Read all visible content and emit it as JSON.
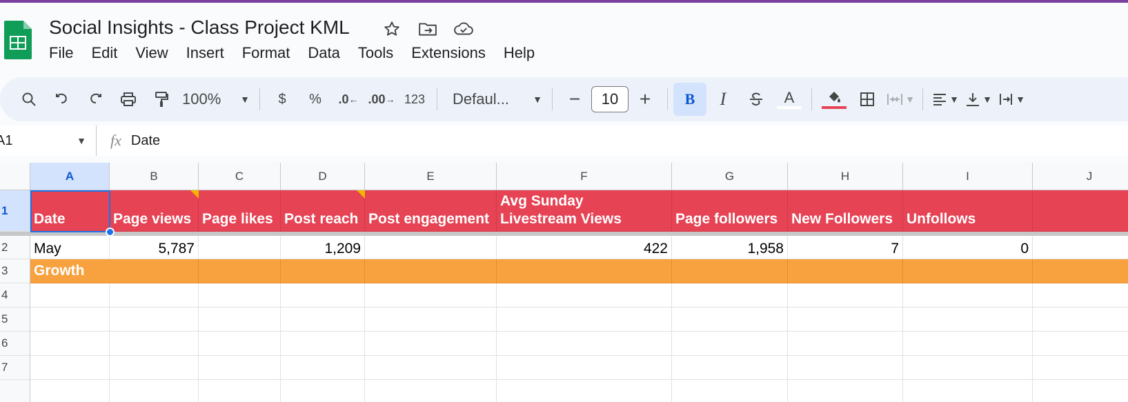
{
  "app": {
    "title": "Social Insights - Class Project KML"
  },
  "title_icons": [
    "star-icon",
    "move-to-folder-icon",
    "cloud-saved-icon"
  ],
  "menu": [
    "File",
    "Edit",
    "View",
    "Insert",
    "Format",
    "Data",
    "Tools",
    "Extensions",
    "Help"
  ],
  "toolbar": {
    "zoom": "100%",
    "currency": "$",
    "percent": "%",
    "decrease_decimal": ".0",
    "increase_decimal": ".00",
    "more_formats": "123",
    "font": "Defaul...",
    "font_size": "10",
    "minus": "−",
    "plus": "+",
    "bold": "B",
    "italic": "I",
    "text_color": "A"
  },
  "formula_bar": {
    "name_box": "A1",
    "fx": "fx",
    "value": "Date"
  },
  "columns": [
    "A",
    "B",
    "C",
    "D",
    "E",
    "F",
    "G",
    "H",
    "I",
    "J"
  ],
  "rows": [
    "1",
    "2",
    "3",
    "4",
    "5",
    "6",
    "7"
  ],
  "header_row": {
    "A": "Date",
    "B": "Page views",
    "C": "Page likes",
    "D": "Post reach",
    "E": "Post engagement",
    "F_line1": "Avg Sunday",
    "F_line2": "Livestream Views",
    "G": "Page followers",
    "H": "New Followers",
    "I": "Unfollows",
    "J": ""
  },
  "row2": {
    "A": "May",
    "B": "5,787",
    "C": "",
    "D": "1,209",
    "E": "",
    "F": "422",
    "G": "1,958",
    "H": "7",
    "I": "0",
    "J": ""
  },
  "row3": {
    "A": "Growth"
  },
  "colors": {
    "header_fill": "#e64354",
    "growth_fill": "#f8a13f",
    "selection": "#1a73e8",
    "note_triangle": "#f5b400"
  }
}
